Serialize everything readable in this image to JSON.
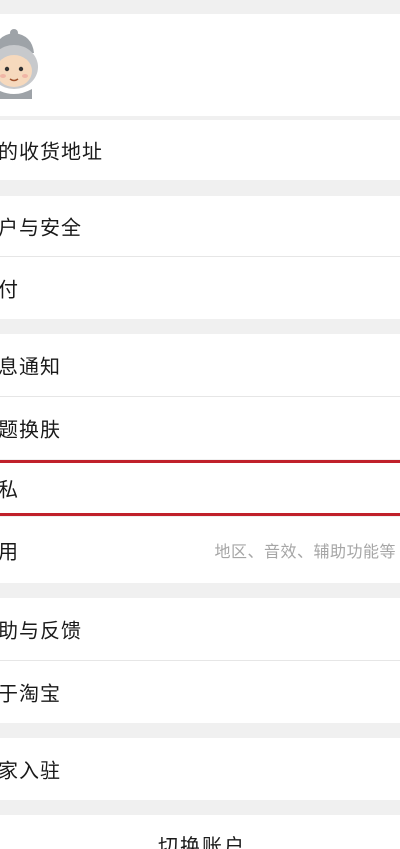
{
  "profile": {
    "avatar_icon": "cartoon-avatar-icon"
  },
  "menu": {
    "address": "的收货地址",
    "account_security": "户与安全",
    "pay": "付",
    "notifications": "息通知",
    "theme": "题换肤",
    "privacy": "私",
    "general": "用",
    "general_sub": "地区、音效、辅助功能等",
    "help": "助与反馈",
    "about": "于淘宝",
    "merchant": "家入驻"
  },
  "footer": {
    "switch_account": "切换账户"
  },
  "colors": {
    "highlight": "#c0202a",
    "background": "#f0f0f0",
    "subtext": "#a6a6a6"
  }
}
